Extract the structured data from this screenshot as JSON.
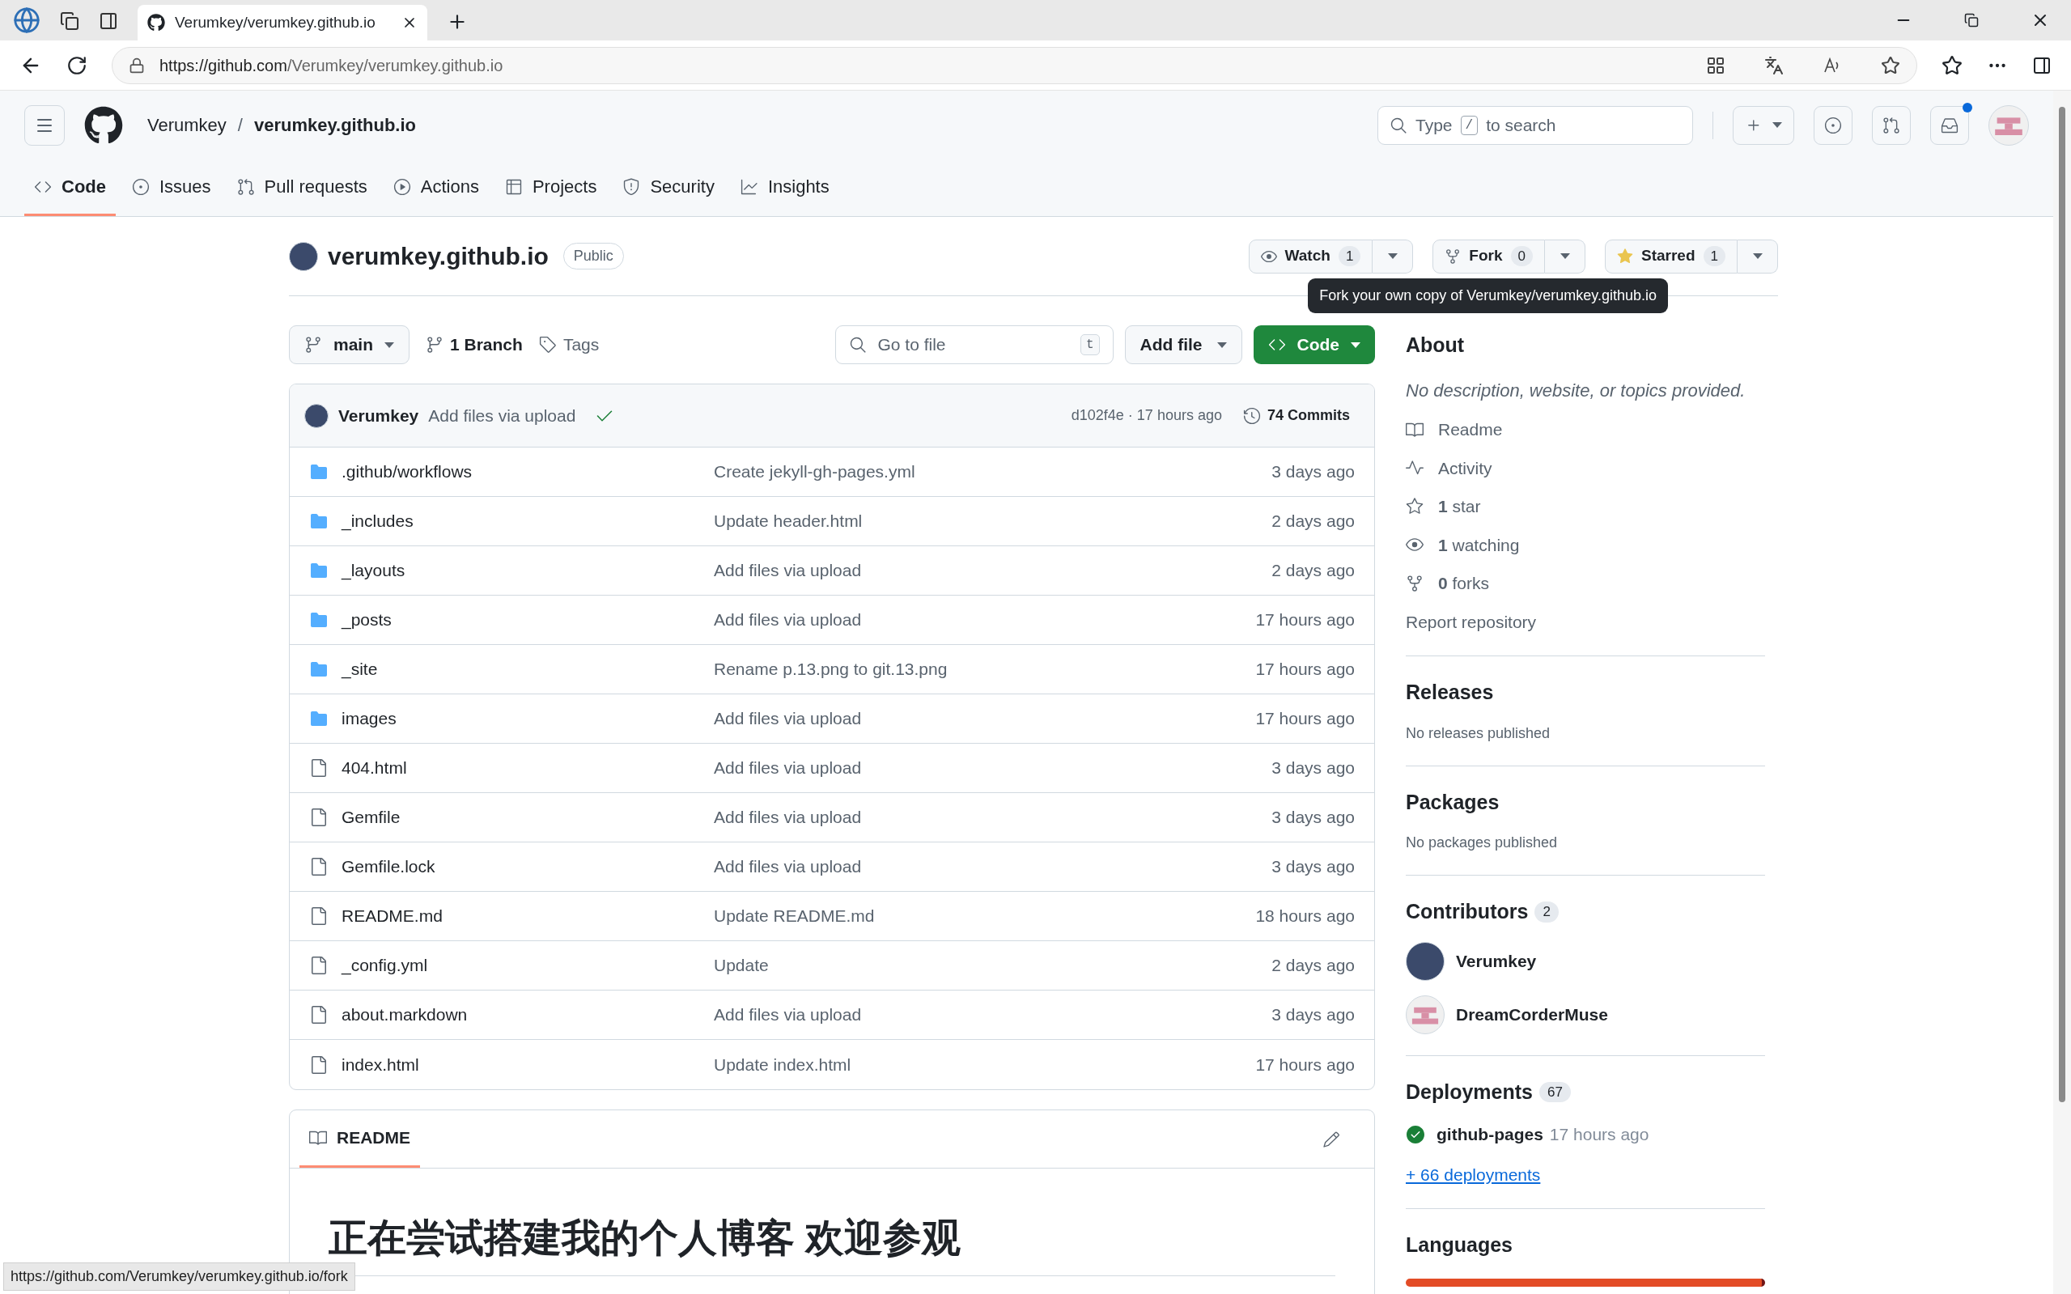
{
  "browser": {
    "tab_title": "Verumkey/verumkey.github.io",
    "url_host": "https://github.com",
    "url_path": "/Verumkey/verumkey.github.io",
    "status_url": "https://github.com/Verumkey/verumkey.github.io/fork"
  },
  "header": {
    "owner": "Verumkey",
    "separator": "/",
    "repo": "verumkey.github.io",
    "search_before": "Type",
    "search_key": "/",
    "search_after": "to search",
    "notification_dot": true
  },
  "tabs": [
    {
      "label": "Code",
      "selected": true
    },
    {
      "label": "Issues",
      "selected": false
    },
    {
      "label": "Pull requests",
      "selected": false
    },
    {
      "label": "Actions",
      "selected": false
    },
    {
      "label": "Projects",
      "selected": false
    },
    {
      "label": "Security",
      "selected": false
    },
    {
      "label": "Insights",
      "selected": false
    }
  ],
  "repo": {
    "name": "verumkey.github.io",
    "visibility": "Public",
    "actions": [
      {
        "kind": "watch",
        "label": "Watch",
        "count": "1"
      },
      {
        "kind": "fork",
        "label": "Fork",
        "count": "0"
      },
      {
        "kind": "star",
        "label": "Starred",
        "count": "1"
      }
    ],
    "tooltip": "Fork your own copy of Verumkey/verumkey.github.io"
  },
  "toolbar": {
    "branch": "main",
    "branches": "1 Branch",
    "tags": "Tags",
    "goto_placeholder": "Go to file",
    "goto_key": "t",
    "add_file": "Add file",
    "code": "Code"
  },
  "commit": {
    "author": "Verumkey",
    "message": "Add files via upload",
    "hash_time": "d102f4e · 17 hours ago",
    "commits": "74 Commits"
  },
  "files": [
    {
      "kind": "folder",
      "name": ".github/workflows",
      "message": "Create jekyll-gh-pages.yml",
      "time": "3 days ago"
    },
    {
      "kind": "folder",
      "name": "_includes",
      "message": "Update header.html",
      "time": "2 days ago"
    },
    {
      "kind": "folder",
      "name": "_layouts",
      "message": "Add files via upload",
      "time": "2 days ago"
    },
    {
      "kind": "folder",
      "name": "_posts",
      "message": "Add files via upload",
      "time": "17 hours ago"
    },
    {
      "kind": "folder",
      "name": "_site",
      "message": "Rename p.13.png to git.13.png",
      "time": "17 hours ago"
    },
    {
      "kind": "folder",
      "name": "images",
      "message": "Add files via upload",
      "time": "17 hours ago"
    },
    {
      "kind": "file",
      "name": "404.html",
      "message": "Add files via upload",
      "time": "3 days ago"
    },
    {
      "kind": "file",
      "name": "Gemfile",
      "message": "Add files via upload",
      "time": "3 days ago"
    },
    {
      "kind": "file",
      "name": "Gemfile.lock",
      "message": "Add files via upload",
      "time": "3 days ago"
    },
    {
      "kind": "file",
      "name": "README.md",
      "message": "Update README.md",
      "time": "18 hours ago"
    },
    {
      "kind": "file",
      "name": "_config.yml",
      "message": "Update",
      "time": "2 days ago"
    },
    {
      "kind": "file",
      "name": "about.markdown",
      "message": "Add files via upload",
      "time": "3 days ago"
    },
    {
      "kind": "file",
      "name": "index.html",
      "message": "Update index.html",
      "time": "17 hours ago"
    }
  ],
  "readme": {
    "tab": "README",
    "heading": "正在尝试搭建我的个人博客 欢迎参观"
  },
  "about": {
    "title": "About",
    "description": "No description, website, or topics provided.",
    "items": [
      {
        "text": "Readme"
      },
      {
        "text": "Activity"
      },
      {
        "text": "**1** star"
      },
      {
        "text": "**1** watching"
      },
      {
        "text": "**0** forks"
      }
    ],
    "report": "Report repository"
  },
  "releases": {
    "title": "Releases",
    "note": "No releases published"
  },
  "packages": {
    "title": "Packages",
    "note": "No packages published"
  },
  "contributors": {
    "title": "Contributors",
    "count": "2",
    "people": [
      {
        "name": "Verumkey"
      },
      {
        "name": "DreamCorderMuse"
      }
    ]
  },
  "deployments": {
    "title": "Deployments",
    "count": "67",
    "env": "github-pages",
    "time": "17 hours ago",
    "more": "+ 66 deployments"
  },
  "languages": {
    "title": "Languages"
  }
}
